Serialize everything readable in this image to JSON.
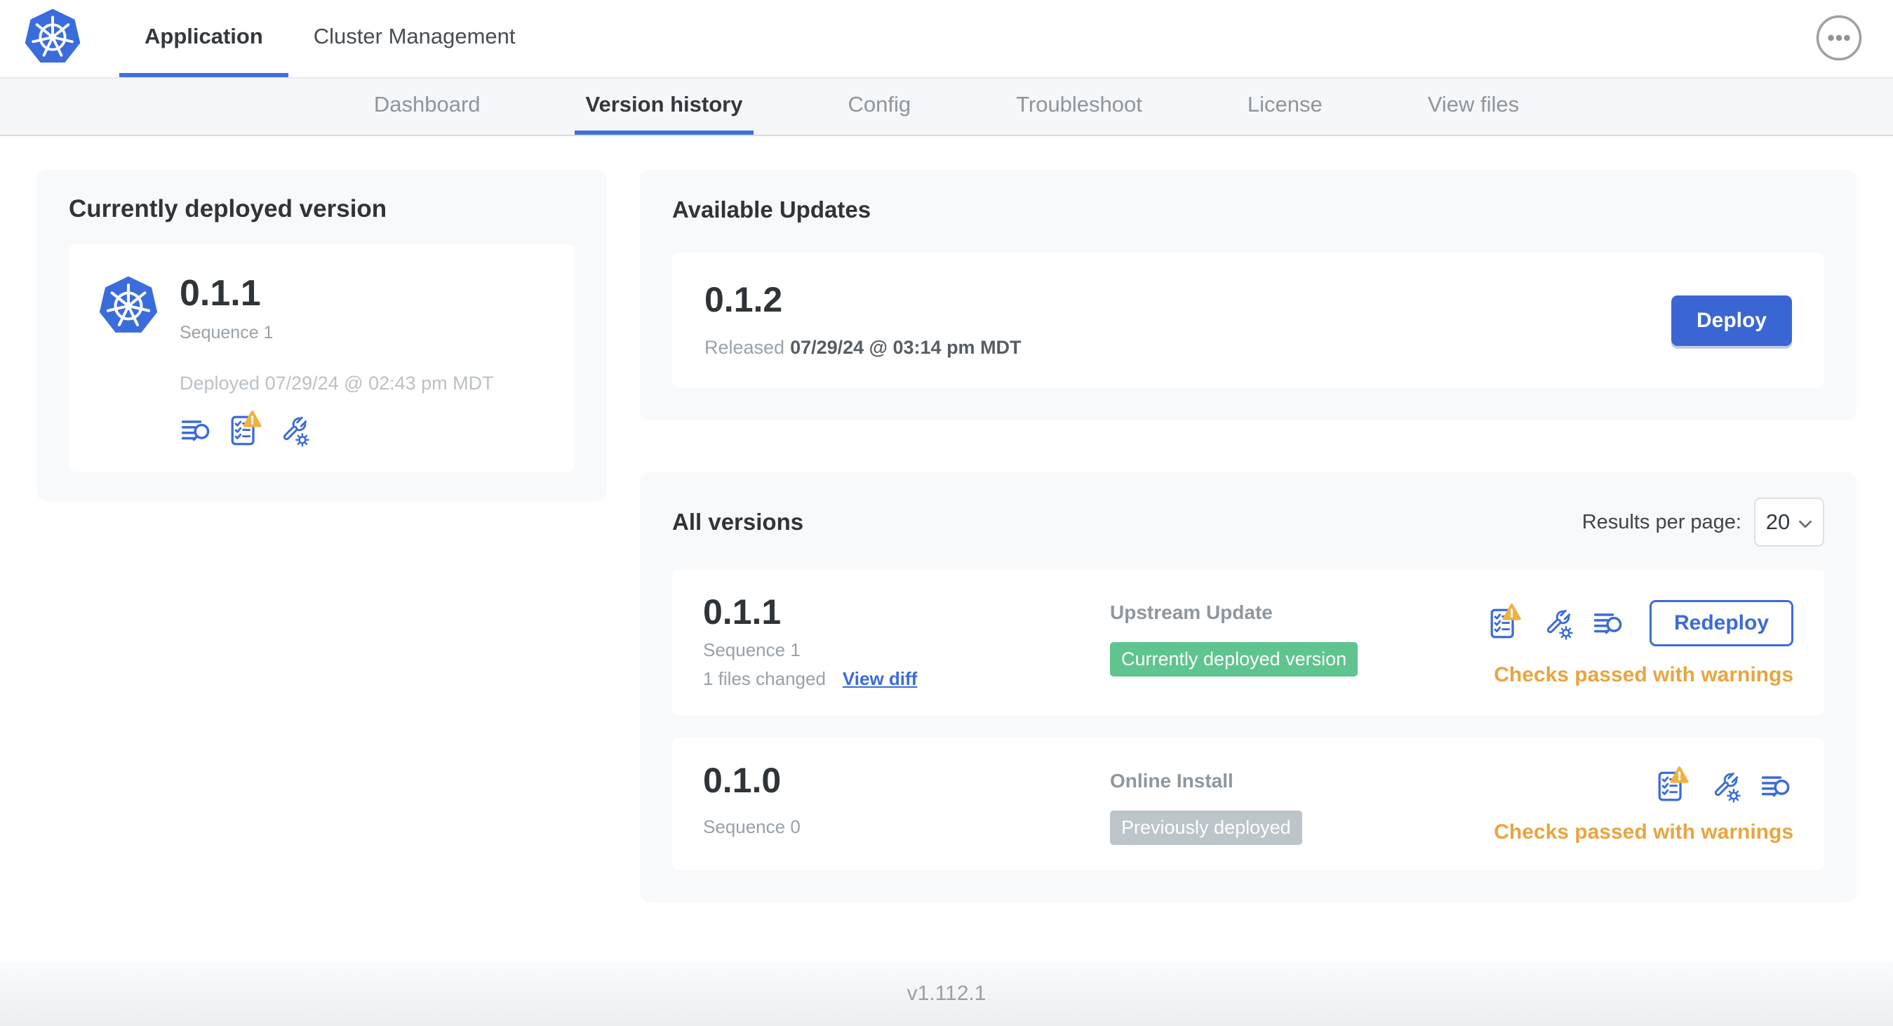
{
  "header": {
    "tabs": [
      {
        "label": "Application",
        "active": true
      },
      {
        "label": "Cluster Management",
        "active": false
      }
    ]
  },
  "subnav": {
    "tabs": [
      {
        "label": "Dashboard",
        "active": false
      },
      {
        "label": "Version history",
        "active": true
      },
      {
        "label": "Config",
        "active": false
      },
      {
        "label": "Troubleshoot",
        "active": false
      },
      {
        "label": "License",
        "active": false
      },
      {
        "label": "View files",
        "active": false
      }
    ]
  },
  "current_version": {
    "title": "Currently deployed version",
    "version": "0.1.1",
    "sequence": "Sequence 1",
    "deployed": "Deployed 07/29/24 @ 02:43 pm MDT"
  },
  "available_updates": {
    "title": "Available Updates",
    "version": "0.1.2",
    "released_label": "Released",
    "released_date": "07/29/24 @ 03:14 pm MDT",
    "deploy_label": "Deploy"
  },
  "all_versions": {
    "title": "All versions",
    "results_per_page_label": "Results per page:",
    "results_per_page_value": "20",
    "rows": [
      {
        "version": "0.1.1",
        "sequence": "Sequence 1",
        "files_changed": "1 files changed",
        "view_diff_label": "View diff",
        "source": "Upstream Update",
        "badge": "Currently deployed version",
        "badge_style": "green",
        "status": "Checks passed with warnings",
        "action_label": "Redeploy"
      },
      {
        "version": "0.1.0",
        "sequence": "Sequence 0",
        "source": "Online Install",
        "badge": "Previously deployed",
        "badge_style": "gray",
        "status": "Checks passed with warnings"
      }
    ]
  },
  "footer": {
    "version": "v1.112.1"
  },
  "colors": {
    "accent_blue": "#3B6BD9",
    "button_blue": "#3A66D4",
    "badge_green": "#5FC48E",
    "badge_gray": "#BCC5CA",
    "warning_amber": "#E9A53F",
    "logo_blue": "#3A6DDB"
  },
  "icons": {
    "logo": "kubernetes-logo",
    "more": "ellipsis-icon",
    "logs": "logs-search-icon",
    "preflight": "checklist-warning-icon",
    "config": "wrench-gear-icon",
    "chevron": "chevron-down-icon",
    "warning": "warning-triangle-icon"
  }
}
